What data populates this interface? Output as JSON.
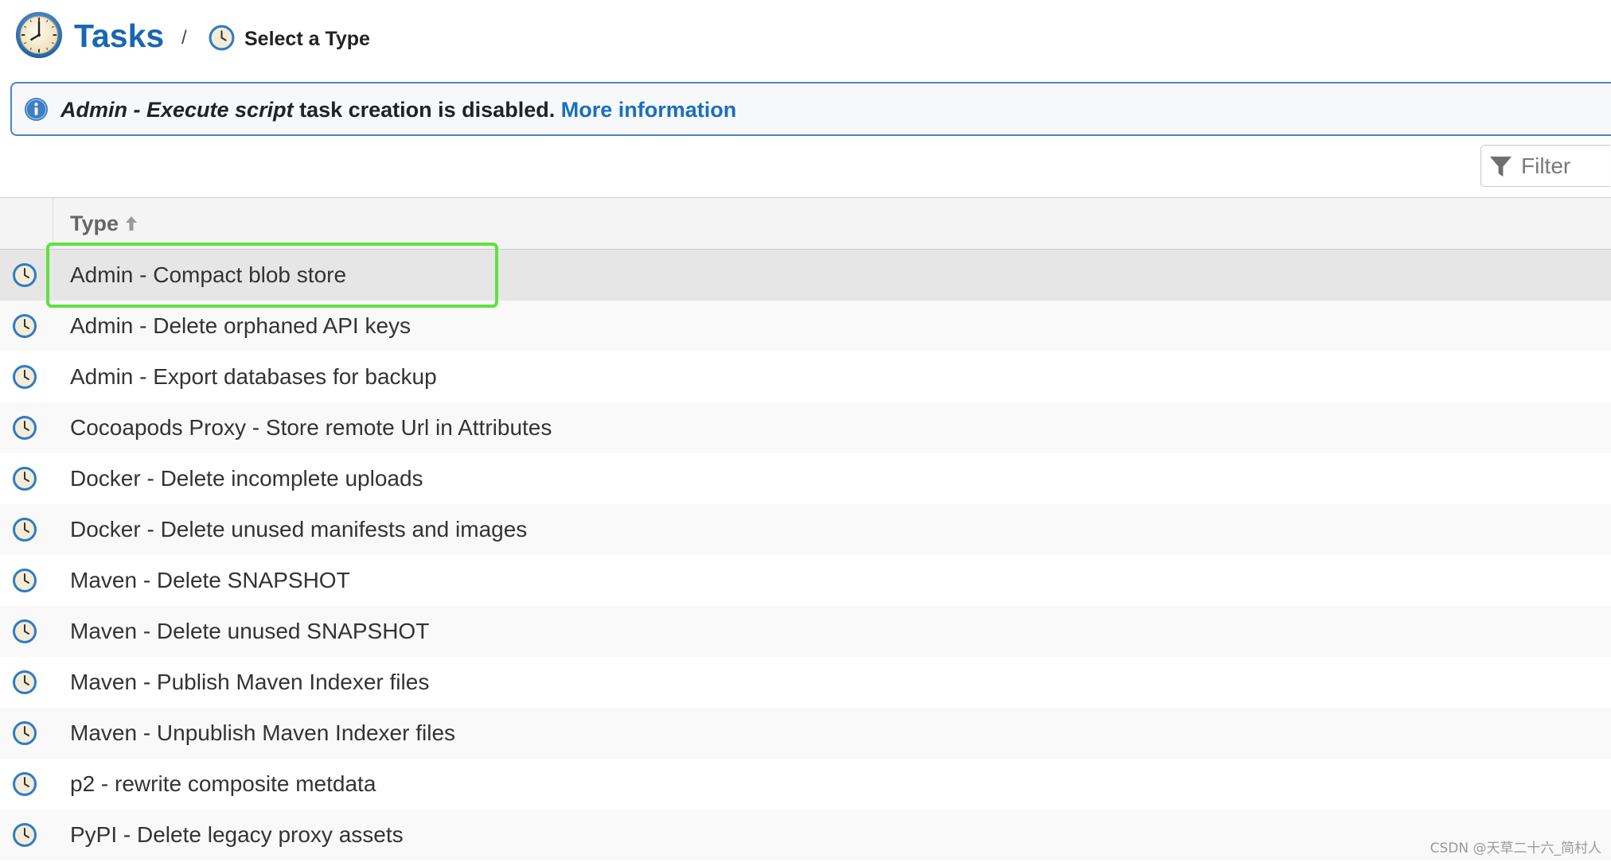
{
  "header": {
    "title": "Tasks",
    "separator": "/",
    "subtitle": "Select a Type",
    "title_icon": "clock-icon"
  },
  "banner": {
    "icon": "info-icon",
    "emphasis": "Admin - Execute script",
    "text": " task creation is disabled. ",
    "link": "More information"
  },
  "filter": {
    "icon": "funnel-icon",
    "placeholder": "Filter",
    "value": ""
  },
  "table": {
    "columns": [
      {
        "label": "Type",
        "sort": "ascending"
      }
    ],
    "selected_index": 0,
    "rows": [
      {
        "label": "Admin - Compact blob store",
        "icon": "clock-icon"
      },
      {
        "label": "Admin - Delete orphaned API keys",
        "icon": "clock-icon"
      },
      {
        "label": "Admin - Export databases for backup",
        "icon": "clock-icon"
      },
      {
        "label": "Cocoapods Proxy - Store remote Url in Attributes",
        "icon": "clock-icon"
      },
      {
        "label": "Docker - Delete incomplete uploads",
        "icon": "clock-icon"
      },
      {
        "label": "Docker - Delete unused manifests and images",
        "icon": "clock-icon"
      },
      {
        "label": "Maven - Delete SNAPSHOT",
        "icon": "clock-icon"
      },
      {
        "label": "Maven - Delete unused SNAPSHOT",
        "icon": "clock-icon"
      },
      {
        "label": "Maven - Publish Maven Indexer files",
        "icon": "clock-icon"
      },
      {
        "label": "Maven - Unpublish Maven Indexer files",
        "icon": "clock-icon"
      },
      {
        "label": "p2 - rewrite composite metdata",
        "icon": "clock-icon"
      },
      {
        "label": "PyPI - Delete legacy proxy assets",
        "icon": "clock-icon"
      }
    ]
  },
  "watermark": "CSDN @天草二十六_简村人",
  "colors": {
    "brand_blue": "#1a66b3",
    "link_blue": "#1a6fc0",
    "banner_border": "#4a86c5",
    "selected_row": "#e6e6e6",
    "alt_row": "#f9f9f9",
    "highlight_green": "#62e040"
  }
}
